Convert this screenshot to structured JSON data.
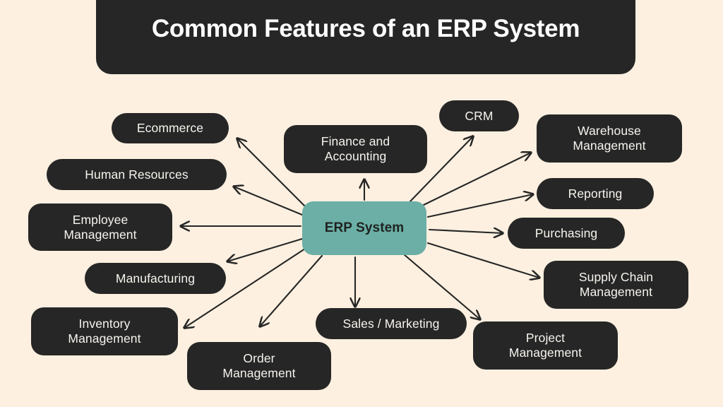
{
  "header": {
    "title": "Common Features of an ERP System"
  },
  "diagram": {
    "type": "hub-and-spoke",
    "center": {
      "label": "ERP System",
      "fill": "#6BAFA6",
      "text_color": "#1F2220"
    },
    "node_fill": "#262626",
    "node_text_color": "#F7F4EE",
    "background": "#FDF0E0",
    "arrow_color": "#262626",
    "arrow_direction": "center-to-node",
    "nodes": [
      {
        "id": "ecommerce",
        "label": "Ecommerce"
      },
      {
        "id": "human-resources",
        "label": "Human Resources"
      },
      {
        "id": "employee-management",
        "label": "Employee\nManagement"
      },
      {
        "id": "manufacturing",
        "label": "Manufacturing"
      },
      {
        "id": "inventory-management",
        "label": "Inventory\nManagement"
      },
      {
        "id": "order-management",
        "label": "Order\nManagement"
      },
      {
        "id": "sales-marketing",
        "label": "Sales / Marketing"
      },
      {
        "id": "project-management",
        "label": "Project\nManagement"
      },
      {
        "id": "supply-chain-management",
        "label": "Supply Chain\nManagement"
      },
      {
        "id": "purchasing",
        "label": "Purchasing"
      },
      {
        "id": "reporting",
        "label": "Reporting"
      },
      {
        "id": "warehouse-management",
        "label": "Warehouse\nManagement"
      },
      {
        "id": "crm",
        "label": "CRM"
      },
      {
        "id": "finance-accounting",
        "label": "Finance and\nAccounting"
      }
    ]
  }
}
